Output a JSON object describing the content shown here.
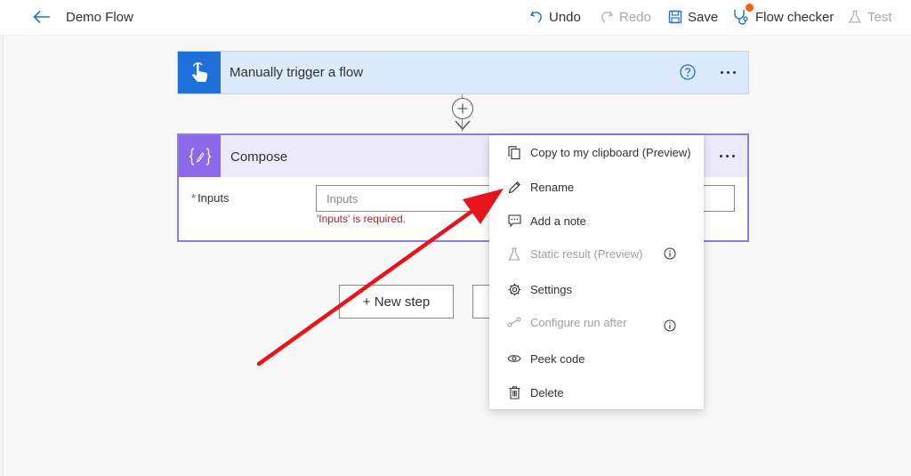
{
  "header": {
    "flow_title": "Demo Flow",
    "undo_label": "Undo",
    "redo_label": "Redo",
    "save_label": "Save",
    "flow_checker_label": "Flow checker",
    "test_label": "Test"
  },
  "trigger": {
    "title": "Manually trigger a flow"
  },
  "compose": {
    "title": "Compose",
    "inputs_label": "Inputs",
    "inputs_required_mark": "*",
    "inputs_value": "",
    "inputs_placeholder": "Inputs",
    "inputs_error": "'Inputs' is required."
  },
  "bottom": {
    "new_step_label": "+ New step"
  },
  "context_menu": {
    "items": [
      {
        "label": "Copy to my clipboard (Preview)",
        "icon": "copy-icon",
        "disabled": false
      },
      {
        "label": "Rename",
        "icon": "pencil-icon",
        "disabled": false
      },
      {
        "label": "Add a note",
        "icon": "comment-icon",
        "disabled": false
      },
      {
        "label": "Static result (Preview)",
        "icon": "flask-icon",
        "disabled": true
      },
      {
        "label": "Settings",
        "icon": "gear-icon",
        "disabled": false
      },
      {
        "label": "Configure run after",
        "icon": "run-after-icon",
        "disabled": true
      },
      {
        "label": "Peek code",
        "icon": "eye-icon",
        "disabled": false
      },
      {
        "label": "Delete",
        "icon": "trash-icon",
        "disabled": false
      }
    ]
  },
  "colors": {
    "accent_blue": "#1e6fd9",
    "compose_purple": "#8c68eb",
    "error_red": "#a4262c",
    "annotation_arrow": "#e8141b",
    "checker_dot": "#f7630c"
  }
}
